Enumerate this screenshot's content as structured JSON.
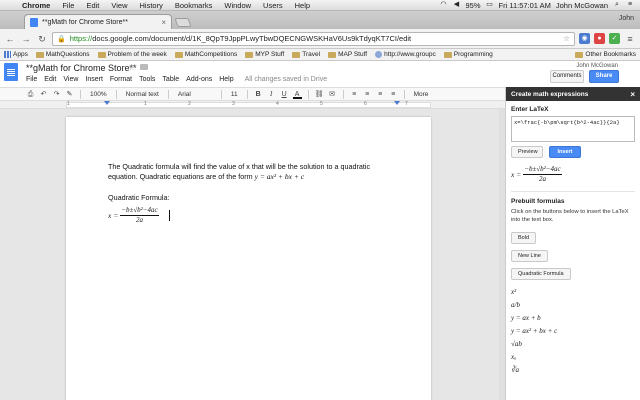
{
  "menubar": {
    "app": "Chrome",
    "items": [
      "File",
      "Edit",
      "View",
      "History",
      "Bookmarks",
      "Window",
      "Users",
      "Help"
    ],
    "battery": "95%",
    "clock": "Fri 11:57:01 AM",
    "user": "John McGowan"
  },
  "browser": {
    "tab_title": "**gMath for Chrome Store**",
    "url_scheme": "https://",
    "url_rest": "docs.google.com/document/d/1K_8QpT9JppPLwyTbwDQECNGWSKHaV6Us9kTdyqKT7CI/edit",
    "user_badge": "John"
  },
  "bookmarks": {
    "items": [
      "Apps",
      "MathQuestions",
      "Problem of the week",
      "MathCompetitions",
      "MYP Stuff",
      "Travel",
      "MAP Stuff",
      "http://www.groupc",
      "Programming"
    ],
    "other": "Other Bookmarks"
  },
  "docs": {
    "title": "**gMath for Chrome Store**",
    "menu": [
      "File",
      "Edit",
      "View",
      "Insert",
      "Format",
      "Tools",
      "Table",
      "Add-ons",
      "Help"
    ],
    "saved_status": "All changes saved in Drive",
    "user": "John McGowan",
    "comments_label": "Comments",
    "share_label": "Share"
  },
  "format_bar": {
    "zoom": "100%",
    "style": "Normal text",
    "font": "Arial",
    "size": "11",
    "more": "More"
  },
  "ruler": {
    "numbers": [
      "1",
      "1",
      "2",
      "3",
      "4",
      "5",
      "6",
      "7"
    ]
  },
  "document": {
    "para1_line1": "The Quadratic formula will find the value of x that will be the solution to a quadratic",
    "para1_line2": "equation. Quadratic equations are of the form",
    "inline_form": "y = ax² + bx + c",
    "heading": "Quadratic Formula:",
    "formula_lhs": "x =",
    "formula_num": "−b±√b²−4ac",
    "formula_den": "2a"
  },
  "panel": {
    "title": "Create math expressions",
    "enter_latex": "Enter LaTeX",
    "latex_value": "x=\\frac{-b\\pm\\sqrt{b^2-4ac}}{2a}",
    "preview_label": "Preview",
    "insert_label": "Insert",
    "preview_lhs": "x =",
    "preview_num": "−b±√b²−4ac",
    "preview_den": "2a",
    "prebuilt_title": "Prebuilt formulas",
    "prebuilt_desc": "Click on the buttons below to insert the LaTeX into the text box.",
    "buttons": [
      "Bold",
      "New Line",
      "Quadratic Formula"
    ],
    "formulas": [
      "x²",
      "a/b",
      "y = ax + b",
      "y = ax² + bx + c",
      "√ab",
      "xₐ",
      "∛a"
    ]
  }
}
